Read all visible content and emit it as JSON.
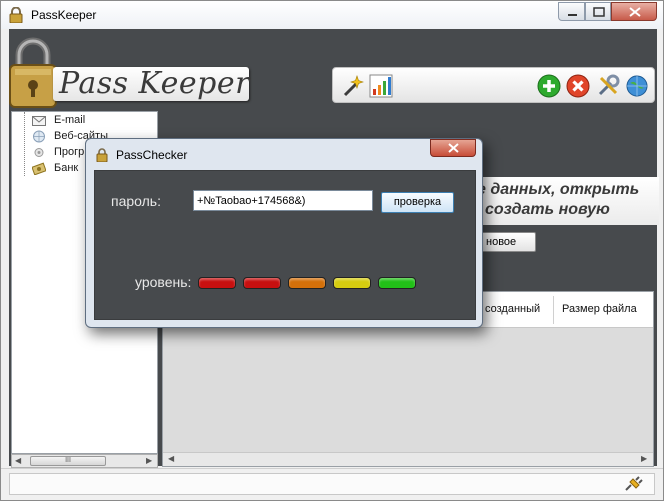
{
  "window": {
    "title": "PassKeeper"
  },
  "logo": {
    "text": "Pass Keeper"
  },
  "toolbar": {
    "icons": [
      "wand-icon",
      "chart-icon",
      "add-icon",
      "delete-icon",
      "settings-icon",
      "globe-icon"
    ]
  },
  "tree": {
    "items": [
      {
        "label": "E-mail",
        "icon": "envelope-icon"
      },
      {
        "label": "Веб-сайты",
        "icon": "globe-icon"
      },
      {
        "label": "Прогр",
        "icon": "program-icon"
      },
      {
        "label": "Банк",
        "icon": "money-icon"
      }
    ],
    "scroll_grip": "III"
  },
  "welcome": {
    "line1": "е данных, открыть",
    "line2": "создать новую",
    "new_button": "новое"
  },
  "grid": {
    "columns": [
      "созданный",
      "Размер файла"
    ]
  },
  "dialog": {
    "title": "PassChecker",
    "password_label": "пароль:",
    "password_value": "+№Taobao+174568&)",
    "check_button": "проверка",
    "level_label": "уровень:",
    "level_colors": [
      "#c81010",
      "#c81010",
      "#d4700a",
      "#d6cc10",
      "#22c018"
    ]
  }
}
